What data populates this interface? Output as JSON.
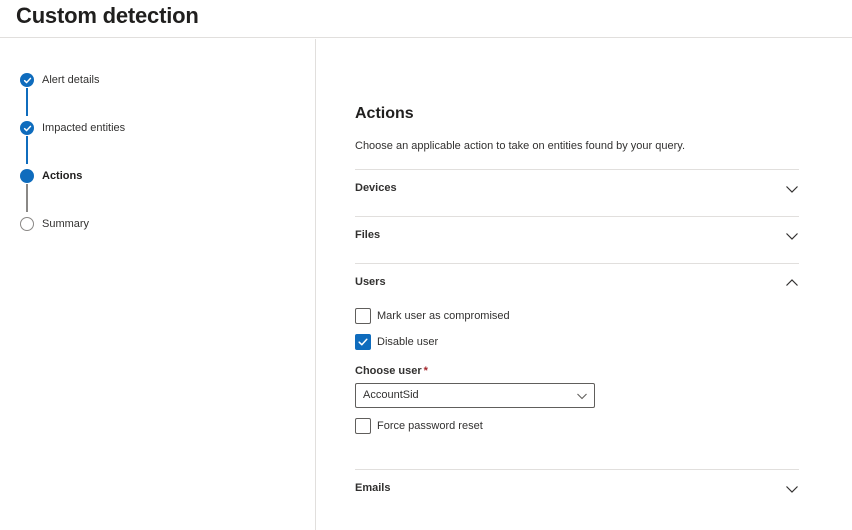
{
  "page": {
    "title": "Custom detection"
  },
  "steps": [
    {
      "label": "Alert details",
      "state": "done"
    },
    {
      "label": "Impacted entities",
      "state": "done"
    },
    {
      "label": "Actions",
      "state": "current"
    },
    {
      "label": "Summary",
      "state": "todo"
    }
  ],
  "actions": {
    "title": "Actions",
    "description": "Choose an applicable action to take on entities found by your query.",
    "sections": {
      "devices": {
        "label": "Devices",
        "expanded": false
      },
      "files": {
        "label": "Files",
        "expanded": false
      },
      "users": {
        "label": "Users",
        "expanded": true
      },
      "emails": {
        "label": "Emails",
        "expanded": false
      }
    },
    "users": {
      "mark_compromised": {
        "label": "Mark user as compromised",
        "checked": false
      },
      "disable_user": {
        "label": "Disable user",
        "checked": true
      },
      "choose_user": {
        "label": "Choose user",
        "required_mark": "*",
        "value": "AccountSid"
      },
      "force_password_reset": {
        "label": "Force password reset",
        "checked": false
      }
    }
  },
  "colors": {
    "accent": "#0f6cbd",
    "border": "#e1dfdd",
    "text": "#323130",
    "required": "#a4262c"
  }
}
